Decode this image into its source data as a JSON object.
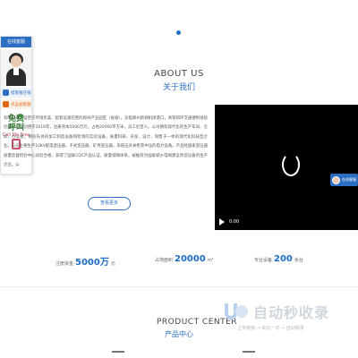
{
  "customer_service": {
    "header": "在线客服",
    "buttons": [
      "搭客服在线",
      "点击加客服"
    ],
    "hotline_line1": "免费",
    "hotline_line2": "呼叫",
    "hotline_line3": "Call Me Free",
    "float_label": "在线客服"
  },
  "about": {
    "title_en": "ABOUT US",
    "title_cn": "关于我们",
    "paragraph": "有限公司，运营于环境优美、配套设施完善的郑州产业园区（省级），东临郑州新郑机场港口，商铁和环交通便利地段优越。公司创建于2019年，注册资本5000万元，占地20000平方米，员工近百人。公司拥有现代化的生产车间、仓库、办公楼，拥有先进的加工制造设备和检测的实验设备，质量科研、开发、设计、制售于一体的现代化科技型企业。公司主要生产10KV配电变压器，干式变压器，矿用变压器，高低压开关柜等中压的电力设备。产品经国家变压器质量监督检验中心试验合格，获得了国家CQC产品认证，质量保障体系，被推荐为国家城乡电网建设改造设备的生产企业。公",
    "more_button": "查看更多"
  },
  "video": {
    "time": "0:00"
  },
  "stats": [
    {
      "label": "注册资金",
      "value": "5000万",
      "unit": "元"
    },
    {
      "label": "占地面积",
      "value": "20000",
      "unit": "m²"
    },
    {
      "label": "专业设备",
      "value": "200",
      "unit": "余台"
    }
  ],
  "products": {
    "title_en": "PRODUCT CENTER",
    "title_cn": "产品中心"
  },
  "watermark": {
    "brand": "自动秒收录",
    "sub": "上传链接 → 来访一次 → 自动收录"
  }
}
